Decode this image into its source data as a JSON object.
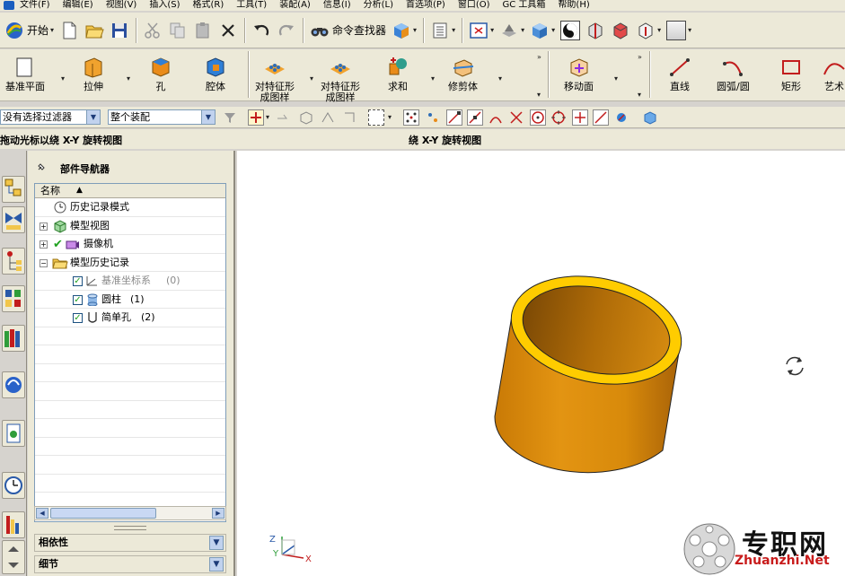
{
  "menubar": {
    "items": [
      "文件(F)",
      "编辑(E)",
      "视图(V)",
      "插入(S)",
      "格式(R)",
      "工具(T)",
      "装配(A)",
      "信息(I)",
      "分析(L)",
      "首选项(P)",
      "窗口(O)",
      "GC 工具箱",
      "帮助(H)"
    ]
  },
  "toolbar1": {
    "start_label": "开始",
    "command_finder_label": "命令查找器"
  },
  "toolbar2": {
    "datum_plane": "基准平面",
    "extrude": "拉伸",
    "hole": "孔",
    "cavity": "腔体",
    "pattern1": "对特征形\n成图样",
    "pattern2": "对特征形\n成图样",
    "unite": "求和",
    "trim_body": "修剪体",
    "move_face": "移动面",
    "line": "直线",
    "arc": "圆弧/圆",
    "rectangle": "矩形",
    "art": "艺术"
  },
  "selection_bar": {
    "filter": "没有选择过滤器",
    "scope": "整个装配"
  },
  "prompt": {
    "left": "拖动光标以绕 X-Y 旋转视图",
    "right": "绕 X-Y 旋转视图"
  },
  "navigator": {
    "title": "部件导航器",
    "column_name": "名称",
    "rows": [
      {
        "label": "历史记录模式",
        "count": ""
      },
      {
        "label": "模型视图",
        "count": ""
      },
      {
        "label": "摄像机",
        "count": ""
      },
      {
        "label": "模型历史记录",
        "count": ""
      },
      {
        "label": "基准坐标系",
        "count": "(0)"
      },
      {
        "label": "圆柱",
        "count": "(1)"
      },
      {
        "label": "简单孔",
        "count": "(2)"
      }
    ],
    "dependency_label": "相依性",
    "details_label": "细节"
  },
  "triad": {
    "x": "X",
    "y": "Y",
    "z": "Z"
  },
  "watermark": {
    "title": "专职网",
    "url": "Zhuanzhi.Net"
  },
  "colors": {
    "cylinder_body": "#d98a0b",
    "cylinder_rim": "#ffcc00",
    "cylinder_inner": "#b06c08"
  }
}
